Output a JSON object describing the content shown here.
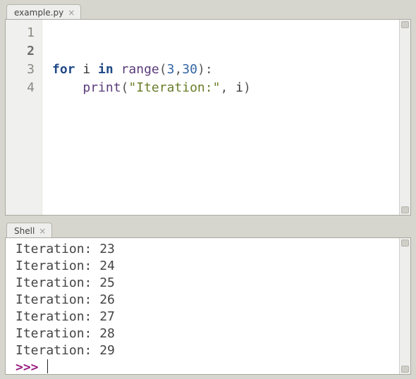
{
  "editor": {
    "tab_label": "example.py",
    "lines": [
      "1",
      "2",
      "3",
      "4"
    ],
    "active_line_index": 1,
    "code": {
      "l3": {
        "kw1": "for",
        "var": "i",
        "kw2": "in",
        "fn": "range",
        "open": "(",
        "n1": "3",
        "comma": ",",
        "n2": "30",
        "close": ")",
        "colon": ":"
      },
      "l4": {
        "indent": "    ",
        "fn": "print",
        "open": "(",
        "str": "\"Iteration:\"",
        "comma": ",",
        "sp": " ",
        "var": "i",
        "close": ")"
      }
    }
  },
  "shell": {
    "tab_label": "Shell",
    "output": [
      "Iteration: 23",
      "Iteration: 24",
      "Iteration: 25",
      "Iteration: 26",
      "Iteration: 27",
      "Iteration: 28",
      "Iteration: 29"
    ],
    "prompt": ">>> "
  }
}
